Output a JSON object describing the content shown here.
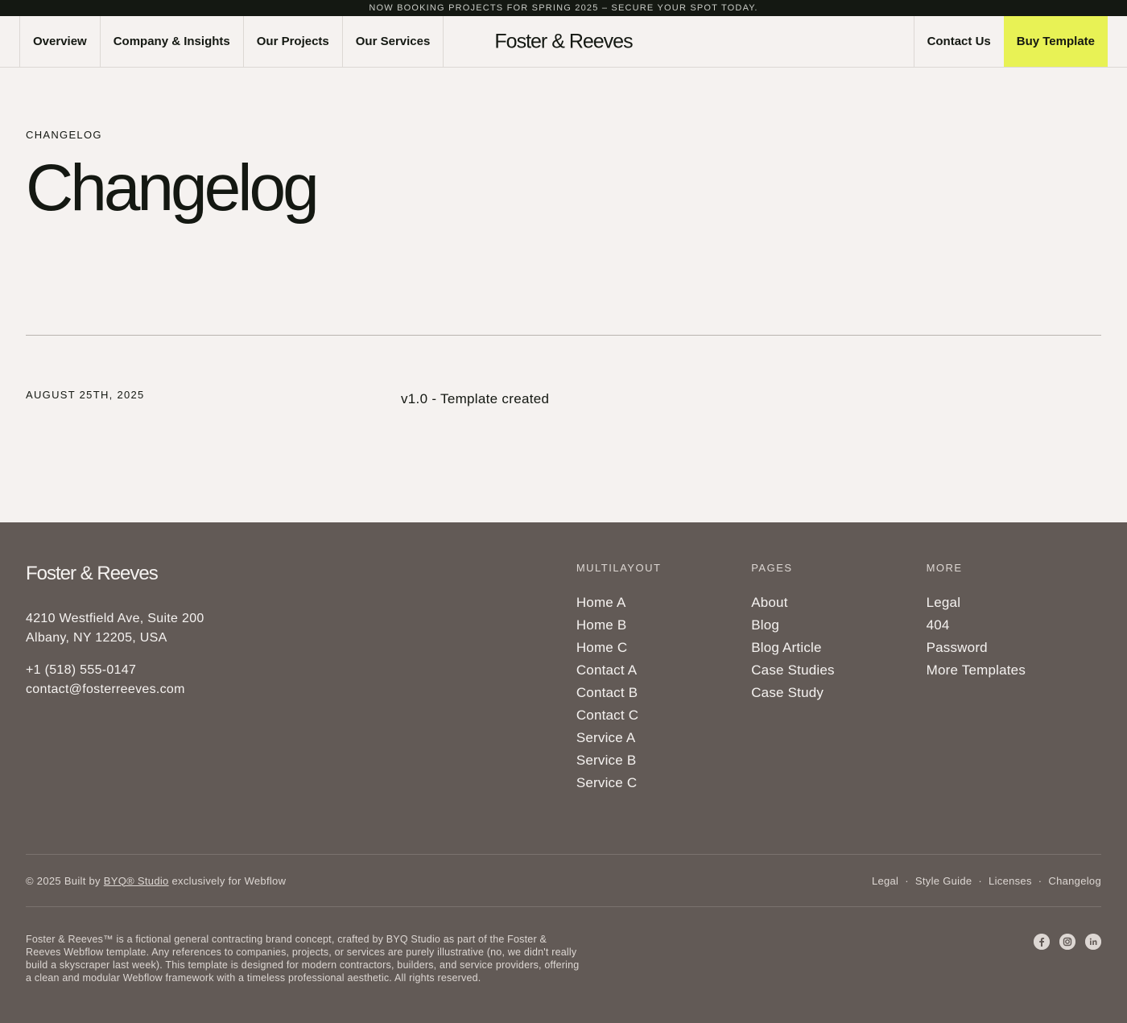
{
  "announcement": "NOW BOOKING PROJECTS FOR SPRING 2025 – SECURE YOUR SPOT TODAY.",
  "nav": {
    "items": [
      "Overview",
      "Company & Insights",
      "Our Projects",
      "Our Services"
    ],
    "logo": "Foster & Reeves",
    "contact": "Contact Us",
    "cta": "Buy Template"
  },
  "hero": {
    "eyebrow": "CHANGELOG",
    "title": "Changelog"
  },
  "entries": [
    {
      "date": "AUGUST 25TH, 2025",
      "text": "v1.0 - Template created"
    }
  ],
  "footer": {
    "logo": "Foster & Reeves",
    "address_line1": "4210 Westfield Ave, Suite 200",
    "address_line2": "Albany, NY 12205, USA",
    "phone": "+1 (518) 555-0147",
    "email": "contact@fosterreeves.com",
    "columns": [
      {
        "title": "MULTILAYOUT",
        "links": [
          "Home A",
          "Home B",
          "Home C",
          "Contact A",
          "Contact B",
          "Contact C",
          "Service A",
          "Service B",
          "Service C"
        ]
      },
      {
        "title": "PAGES",
        "links": [
          "About",
          "Blog",
          "Blog Article",
          "Case Studies",
          "Case Study"
        ]
      },
      {
        "title": "MORE",
        "links": [
          "Legal",
          "404",
          "Password",
          "More Templates"
        ]
      }
    ],
    "copyright_prefix": "© 2025 Built by",
    "copyright_link": "BYQ® Studio",
    "copyright_suffix": "exclusively for Webflow",
    "legal_links": [
      "Legal",
      "Style Guide",
      "Licenses",
      "Changelog"
    ],
    "disclaimer": "Foster & Reeves™ is a fictional general contracting brand concept, crafted by BYQ Studio as part of the Foster & Reeves Webflow template. Any references to companies, projects, or services are purely illustrative (no, we didn't really build a skyscraper last week). This template is designed for modern contractors, builders, and service providers, offering a clean and modular Webflow framework with a timeless professional aesthetic. All rights reserved.",
    "socials": [
      "facebook-icon",
      "instagram-icon",
      "linkedin-icon"
    ]
  },
  "colors": {
    "accent": "#e8f255",
    "dark": "#141812",
    "footer_bg": "#625a56",
    "page_bg": "#f5f2f0"
  }
}
